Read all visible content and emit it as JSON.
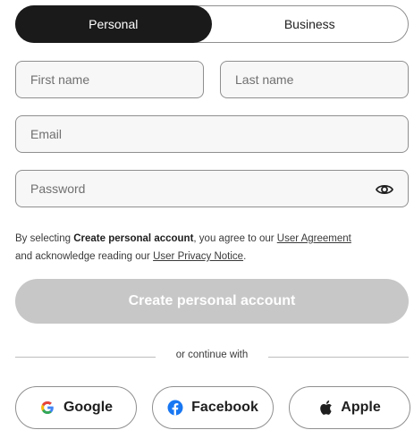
{
  "account_type": {
    "options": [
      {
        "label": "Personal",
        "selected": true
      },
      {
        "label": "Business",
        "selected": false
      }
    ]
  },
  "fields": {
    "first_name_placeholder": "First name",
    "last_name_placeholder": "Last name",
    "email_placeholder": "Email",
    "password_placeholder": "Password",
    "password_toggle_icon": "eye-icon"
  },
  "legal": {
    "prefix": "By selecting ",
    "action_bold": "Create personal account",
    "middle": ", you agree to our ",
    "user_agreement_link": "User Agreement",
    "line2_prefix": "and acknowledge reading our ",
    "privacy_link": "User Privacy Notice",
    "suffix": "."
  },
  "submit": {
    "label": "Create personal account",
    "disabled": true,
    "color": "#c7c7c7"
  },
  "divider_text": "or continue with",
  "social": [
    {
      "label": "Google",
      "icon": "google-icon"
    },
    {
      "label": "Facebook",
      "icon": "facebook-icon"
    },
    {
      "label": "Apple",
      "icon": "apple-icon"
    }
  ],
  "colors": {
    "toggle_active_bg": "#1a1a1a",
    "facebook_blue": "#1877f2",
    "google_blue": "#4285f4"
  }
}
